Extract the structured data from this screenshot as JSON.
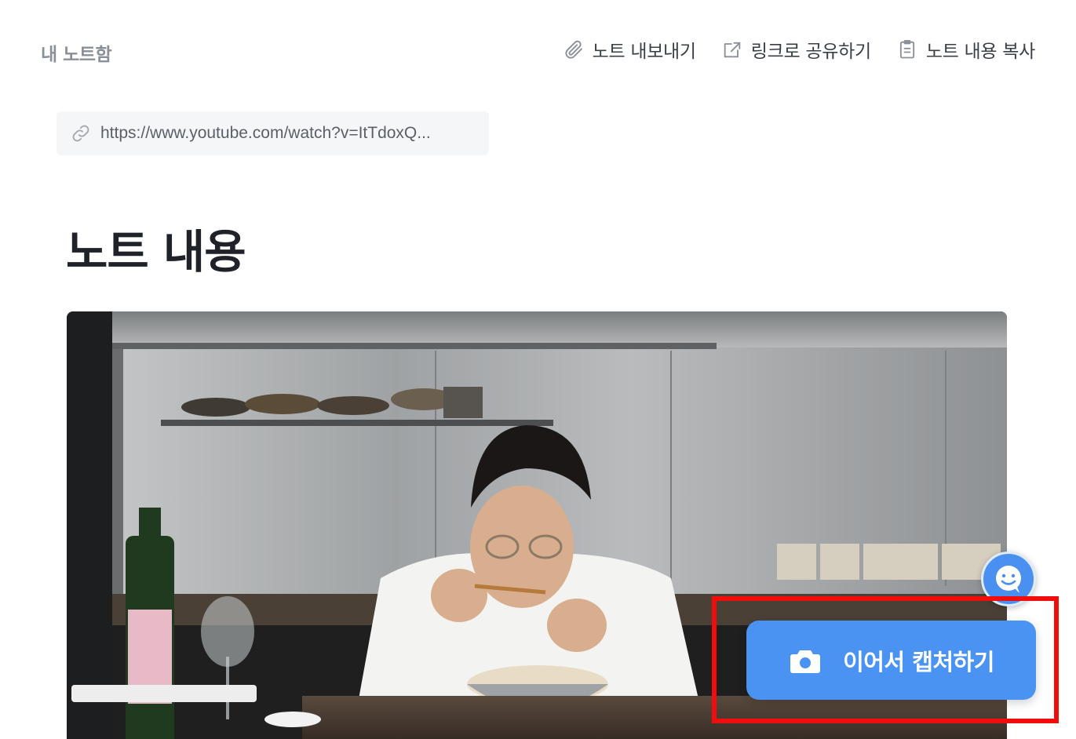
{
  "header": {
    "breadcrumb": "내 노트함",
    "actions": [
      {
        "label": "노트 내보내기",
        "icon": "paperclip-icon"
      },
      {
        "label": "링크로 공유하기",
        "icon": "share-icon"
      },
      {
        "label": "노트 내용 복사",
        "icon": "clipboard-icon"
      }
    ]
  },
  "source": {
    "url": "https://www.youtube.com/watch?v=ItTdoxQ...",
    "icon": "link-icon"
  },
  "main": {
    "title": "노트 내용"
  },
  "capture": {
    "label": "이어서 캡처하기",
    "icon": "camera-icon"
  },
  "colors": {
    "accent": "#4b93f3",
    "highlight": "#f20d0d"
  }
}
